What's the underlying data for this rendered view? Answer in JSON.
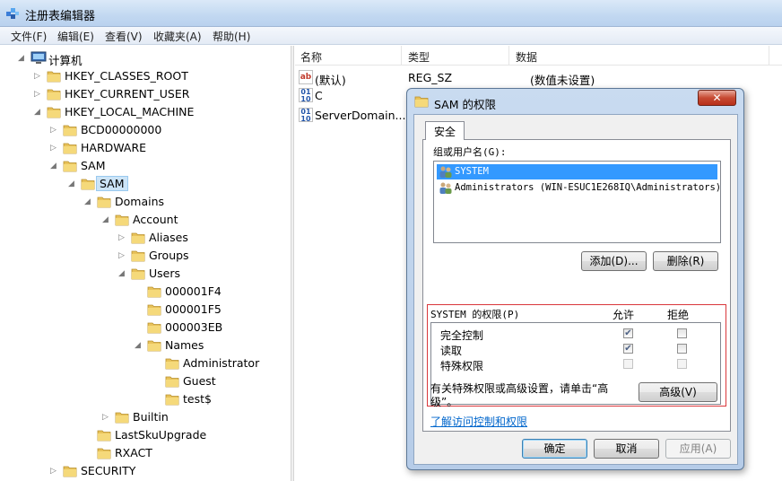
{
  "window": {
    "title": "注册表编辑器"
  },
  "menu": [
    "文件(F)",
    "编辑(E)",
    "查看(V)",
    "收藏夹(A)",
    "帮助(H)"
  ],
  "tree": [
    {
      "label": "计算机",
      "arrow": "◢",
      "icon": "computer-icon"
    },
    {
      "label": "HKEY_CLASSES_ROOT",
      "arrow": "▷"
    },
    {
      "label": "HKEY_CURRENT_USER",
      "arrow": "▷"
    },
    {
      "label": "HKEY_LOCAL_MACHINE",
      "arrow": "◢"
    },
    {
      "label": "BCD00000000",
      "arrow": "▷"
    },
    {
      "label": "HARDWARE",
      "arrow": "▷"
    },
    {
      "label": "SAM",
      "arrow": "◢"
    },
    {
      "label": "SAM",
      "arrow": "◢",
      "selected": true
    },
    {
      "label": "Domains",
      "arrow": "◢"
    },
    {
      "label": "Account",
      "arrow": "◢"
    },
    {
      "label": "Aliases",
      "arrow": "▷"
    },
    {
      "label": "Groups",
      "arrow": "▷"
    },
    {
      "label": "Users",
      "arrow": "◢"
    },
    {
      "label": "000001F4",
      "arrow": ""
    },
    {
      "label": "000001F5",
      "arrow": ""
    },
    {
      "label": "000003EB",
      "arrow": ""
    },
    {
      "label": "Names",
      "arrow": "◢"
    },
    {
      "label": "Administrator",
      "arrow": ""
    },
    {
      "label": "Guest",
      "arrow": ""
    },
    {
      "label": "test$",
      "arrow": ""
    },
    {
      "label": "Builtin",
      "arrow": "▷"
    },
    {
      "label": "LastSkuUpgrade",
      "arrow": ""
    },
    {
      "label": "RXACT",
      "arrow": ""
    },
    {
      "label": "SECURITY",
      "arrow": "▷"
    }
  ],
  "list": {
    "columns": [
      "名称",
      "类型",
      "数据"
    ],
    "rows": [
      {
        "name": "(默认)",
        "type": "REG_SZ",
        "data": "(数值未设置)",
        "icon": "ab"
      },
      {
        "name": "C",
        "type": "",
        "data": "",
        "icon": "bin"
      },
      {
        "name": "ServerDomain...",
        "type": "",
        "data": "",
        "icon": "bin"
      }
    ]
  },
  "dialog": {
    "title": "SAM 的权限",
    "close": "✕",
    "tab": "安全",
    "group_label": "组或用户名(G):",
    "users": [
      {
        "name": "SYSTEM",
        "selected": true
      },
      {
        "name": "Administrators (WIN-ESUC1E268IQ\\Administrators)",
        "selected": false
      }
    ],
    "add_button": "添加(D)...",
    "remove_button": "删除(R)",
    "perm_label": "SYSTEM 的权限(P)",
    "allow_header": "允许",
    "deny_header": "拒绝",
    "permissions": [
      {
        "name": "完全控制",
        "allow": true,
        "deny": false,
        "allow_enabled": true,
        "deny_enabled": true
      },
      {
        "name": "读取",
        "allow": true,
        "deny": false,
        "allow_enabled": true,
        "deny_enabled": true
      },
      {
        "name": "特殊权限",
        "allow": false,
        "deny": false,
        "allow_enabled": false,
        "deny_enabled": false
      }
    ],
    "advanced_text_line1": "有关特殊权限或高级设置，请单击“高",
    "advanced_text_line2": "级”。",
    "advanced_button": "高级(V)",
    "link": "了解访问控制和权限",
    "ok_button": "确定",
    "cancel_button": "取消",
    "apply_button": "应用(A)"
  }
}
